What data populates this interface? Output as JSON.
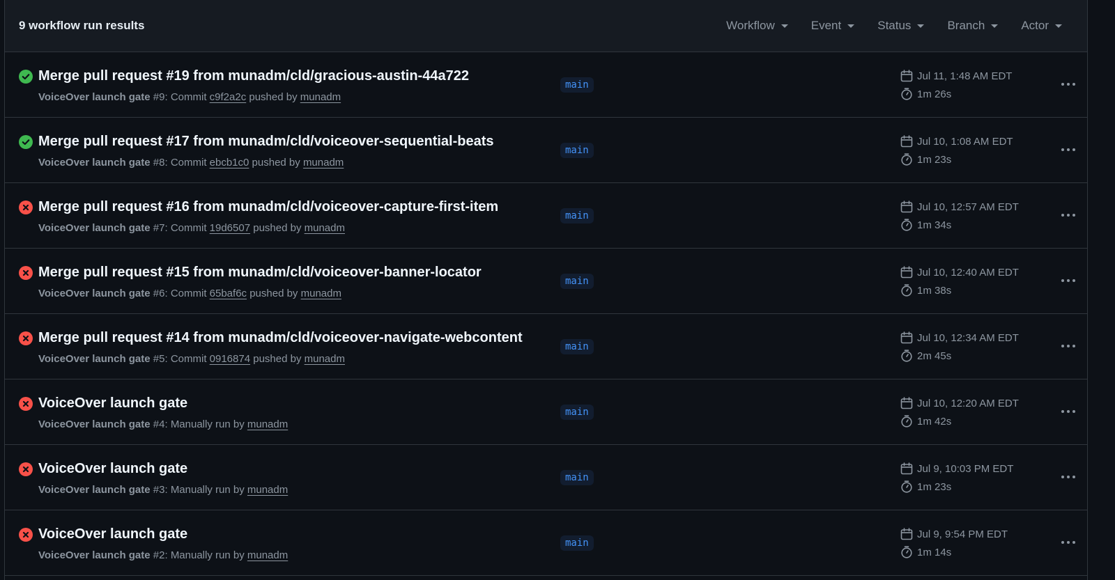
{
  "header": {
    "results_count": "9 workflow run results",
    "filters": [
      {
        "label": "Workflow"
      },
      {
        "label": "Event"
      },
      {
        "label": "Status"
      },
      {
        "label": "Branch"
      },
      {
        "label": "Actor"
      }
    ]
  },
  "colors": {
    "success": "#3fb950",
    "failure": "#f85149",
    "branch_text": "#4493f8"
  },
  "runs": [
    {
      "status": "success",
      "title": "Merge pull request #19 from munadm/cld/gracious-austin-44a722",
      "workflow": "VoiceOver launch gate",
      "run_label": "#9: Commit ",
      "commit": "c9f2a2c",
      "by_text": " pushed by ",
      "actor": "munadm",
      "branch": "main",
      "date": "Jul 11, 1:48 AM EDT",
      "duration": "1m 26s"
    },
    {
      "status": "success",
      "title": "Merge pull request #17 from munadm/cld/voiceover-sequential-beats",
      "workflow": "VoiceOver launch gate",
      "run_label": "#8: Commit ",
      "commit": "ebcb1c0",
      "by_text": " pushed by ",
      "actor": "munadm",
      "branch": "main",
      "date": "Jul 10, 1:08 AM EDT",
      "duration": "1m 23s"
    },
    {
      "status": "failure",
      "title": "Merge pull request #16 from munadm/cld/voiceover-capture-first-item",
      "workflow": "VoiceOver launch gate",
      "run_label": "#7: Commit ",
      "commit": "19d6507",
      "by_text": " pushed by ",
      "actor": "munadm",
      "branch": "main",
      "date": "Jul 10, 12:57 AM EDT",
      "duration": "1m 34s"
    },
    {
      "status": "failure",
      "title": "Merge pull request #15 from munadm/cld/voiceover-banner-locator",
      "workflow": "VoiceOver launch gate",
      "run_label": "#6: Commit ",
      "commit": "65baf6c",
      "by_text": " pushed by ",
      "actor": "munadm",
      "branch": "main",
      "date": "Jul 10, 12:40 AM EDT",
      "duration": "1m 38s"
    },
    {
      "status": "failure",
      "title": "Merge pull request #14 from munadm/cld/voiceover-navigate-webcontent",
      "workflow": "VoiceOver launch gate",
      "run_label": "#5: Commit ",
      "commit": "0916874",
      "by_text": " pushed by ",
      "actor": "munadm",
      "branch": "main",
      "date": "Jul 10, 12:34 AM EDT",
      "duration": "2m 45s"
    },
    {
      "status": "failure",
      "title": "VoiceOver launch gate",
      "workflow": "VoiceOver launch gate",
      "run_label": "#4: Manually run by ",
      "commit": "",
      "by_text": "",
      "actor": "munadm",
      "branch": "main",
      "date": "Jul 10, 12:20 AM EDT",
      "duration": "1m 42s"
    },
    {
      "status": "failure",
      "title": "VoiceOver launch gate",
      "workflow": "VoiceOver launch gate",
      "run_label": "#3: Manually run by ",
      "commit": "",
      "by_text": "",
      "actor": "munadm",
      "branch": "main",
      "date": "Jul 9, 10:03 PM EDT",
      "duration": "1m 23s"
    },
    {
      "status": "failure",
      "title": "VoiceOver launch gate",
      "workflow": "VoiceOver launch gate",
      "run_label": "#2: Manually run by ",
      "commit": "",
      "by_text": "",
      "actor": "munadm",
      "branch": "main",
      "date": "Jul 9, 9:54 PM EDT",
      "duration": "1m 14s"
    }
  ]
}
